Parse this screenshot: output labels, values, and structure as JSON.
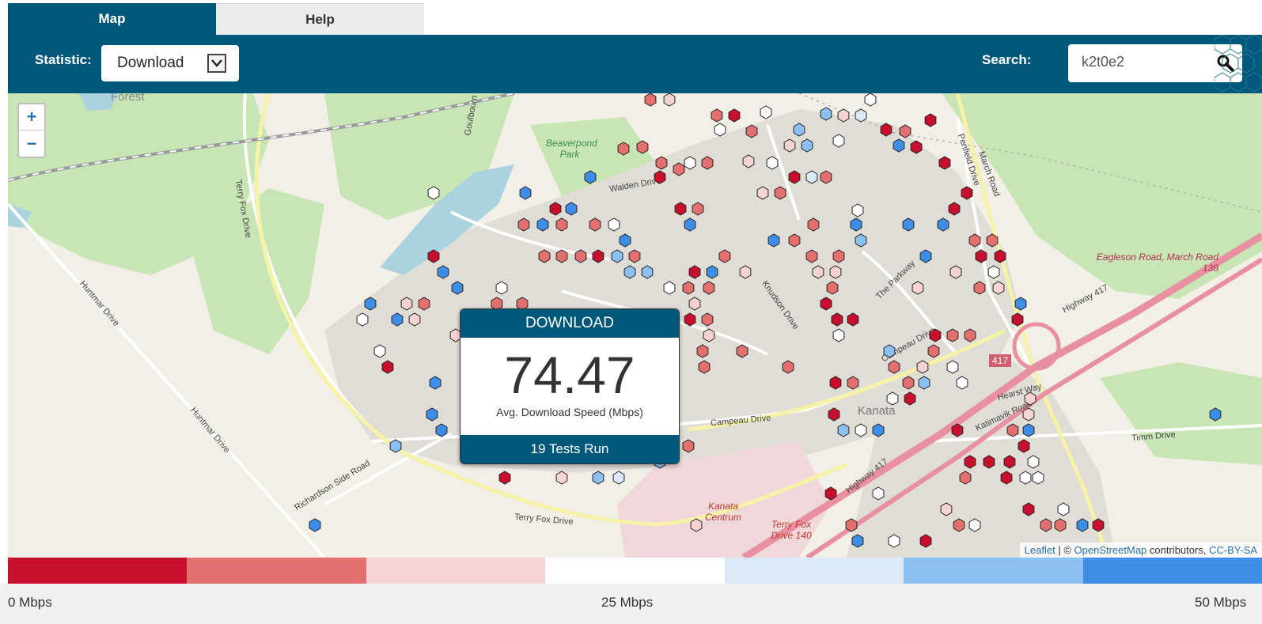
{
  "tabs": [
    {
      "label": "Map",
      "active": true
    },
    {
      "label": "Help",
      "active": false
    }
  ],
  "toolbar": {
    "statistic_label": "Statistic:",
    "statistic_selected": "Download",
    "search_label": "Search:",
    "search_value": "k2t0e2"
  },
  "map": {
    "zoom_in": "+",
    "zoom_out": "−",
    "labels": {
      "park": "Beaverpond Park",
      "town": "Kanata",
      "centrum": "Kanata Centrum",
      "tfd140": "Terry Fox Drive 140",
      "eagleson": "Eagleson Road, March Road 138",
      "hwy417": "417",
      "forest": "Forest"
    },
    "roads": [
      "Terry Fox Drive",
      "Huntmar Drive",
      "Richardson Side Road",
      "Campeau Drive",
      "Highway 417",
      "Knudson Drive",
      "The Parkway",
      "March Road",
      "Penfield Drive",
      "Walden Drive",
      "Goulbourn",
      "Timm Drive",
      "Katimavik Road",
      "Hearst Way"
    ],
    "attribution": {
      "leaflet": "Leaflet",
      "sep": " | © ",
      "osm": "OpenStreetMap",
      "contrib": " contributors, ",
      "license": "CC-BY-SA"
    }
  },
  "popup": {
    "title": "DOWNLOAD",
    "value": "74.47",
    "subtitle": "Avg. Download Speed (Mbps)",
    "tests": "19 Tests Run"
  },
  "legend": {
    "colors": [
      "#c8102e",
      "#e3706e",
      "#f5d3d5",
      "#ffffff",
      "#dceaf8",
      "#8cc0f2",
      "#3e8ee8"
    ],
    "min_label": "0 Mbps",
    "mid_label": "25 Mbps",
    "max_label": "50 Mbps"
  },
  "colors": {
    "brand": "#02587a",
    "map_land": "#f2efe7",
    "map_green": "#c8e5b5",
    "highway": "#e8909f"
  }
}
